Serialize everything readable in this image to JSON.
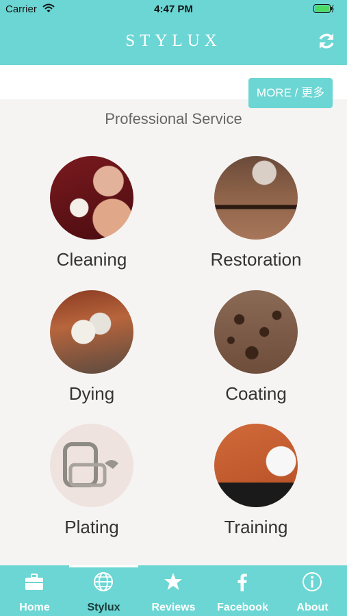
{
  "status": {
    "carrier": "Carrier",
    "time": "4:47 PM"
  },
  "header": {
    "brand": "STYLUX"
  },
  "more_button": "MORE / 更多",
  "section_title": "Professional Service",
  "services": [
    {
      "label": "Cleaning"
    },
    {
      "label": "Restoration"
    },
    {
      "label": "Dying"
    },
    {
      "label": "Coating"
    },
    {
      "label": "Plating"
    },
    {
      "label": "Training"
    }
  ],
  "tabs": [
    {
      "label": "Home",
      "icon": "briefcase-icon"
    },
    {
      "label": "Stylux",
      "icon": "globe-icon",
      "active": true
    },
    {
      "label": "Reviews",
      "icon": "star-icon"
    },
    {
      "label": "Facebook",
      "icon": "facebook-icon"
    },
    {
      "label": "About",
      "icon": "info-icon"
    }
  ],
  "colors": {
    "accent": "#6bd6d3",
    "background": "#f6f4f2",
    "text": "#333333"
  }
}
